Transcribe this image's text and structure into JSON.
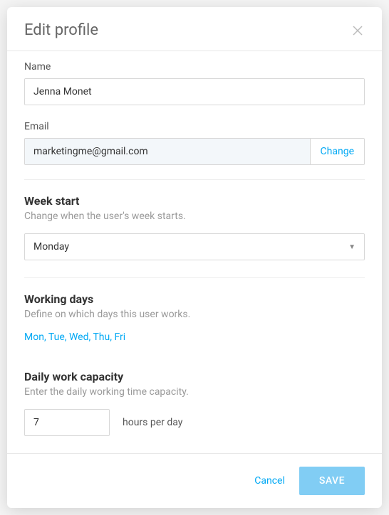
{
  "modal": {
    "title": "Edit profile"
  },
  "name": {
    "label": "Name",
    "value": "Jenna Monet"
  },
  "email": {
    "label": "Email",
    "value": "marketingme@gmail.com",
    "change_label": "Change"
  },
  "week_start": {
    "title": "Week start",
    "desc": "Change when the user's week starts.",
    "value": "Monday"
  },
  "working_days": {
    "title": "Working days",
    "desc": "Define on which days this user works.",
    "value": "Mon, Tue, Wed, Thu, Fri"
  },
  "capacity": {
    "title": "Daily work capacity",
    "desc": "Enter the daily working time capacity.",
    "value": "7",
    "suffix": "hours per day"
  },
  "footer": {
    "cancel": "Cancel",
    "save": "SAVE"
  }
}
